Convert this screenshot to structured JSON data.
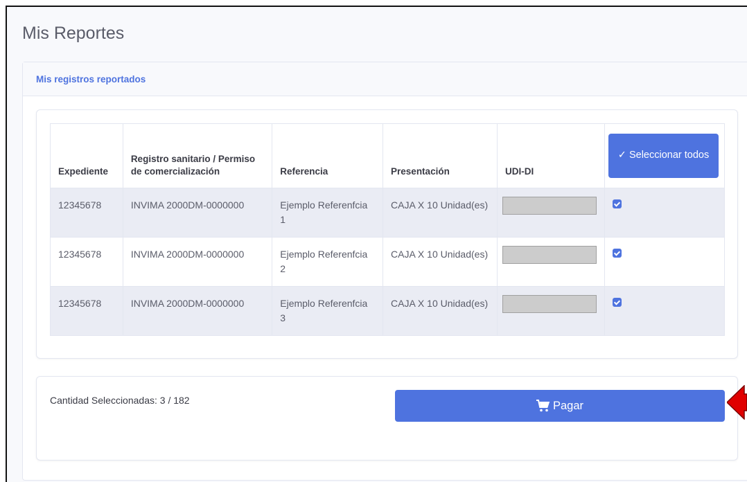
{
  "page": {
    "title": "Mis Reportes"
  },
  "card": {
    "header": "Mis registros reportados"
  },
  "table": {
    "headers": {
      "expediente": "Expediente",
      "registro": "Registro sanitario / Permiso de comercialización",
      "referencia": "Referencia",
      "presentacion": "Presentación",
      "udi": "UDI-DI"
    },
    "select_all_label": "Seleccionar todos",
    "rows": [
      {
        "expediente": "12345678",
        "registro": "INVIMA 2000DM-0000000",
        "referencia": "Ejemplo Referenfcia 1",
        "presentacion": "CAJA X 10 Unidad(es)",
        "udi": "",
        "checked": true
      },
      {
        "expediente": "12345678",
        "registro": "INVIMA 2000DM-0000000",
        "referencia": "Ejemplo Referenfcia 2",
        "presentacion": "CAJA X 10 Unidad(es)",
        "udi": "",
        "checked": true
      },
      {
        "expediente": "12345678",
        "registro": "INVIMA 2000DM-0000000",
        "referencia": "Ejemplo Referenfcia 3",
        "presentacion": "CAJA X 10 Unidad(es)",
        "udi": "",
        "checked": true
      }
    ]
  },
  "footer": {
    "count_text": "Cantidad Seleccionadas: 3 / 182",
    "pay_label": "Pagar"
  },
  "icons": {
    "select_all": "check-icon",
    "pay": "cart-icon",
    "annotation": "red-arrow-icon"
  },
  "colors": {
    "primary": "#4e73df",
    "arrow": "#e00000"
  }
}
